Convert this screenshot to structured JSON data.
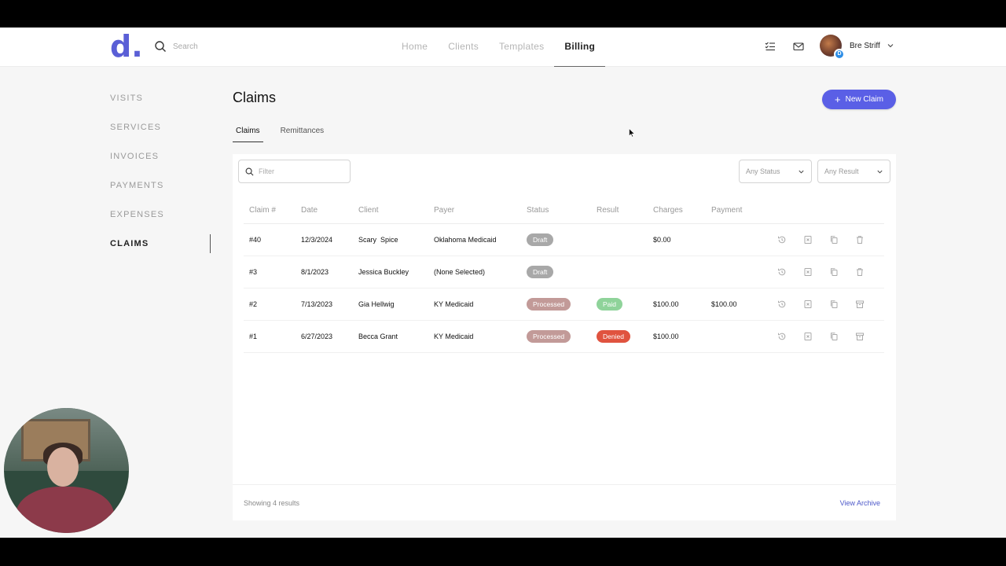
{
  "app": {
    "logo": "d"
  },
  "header": {
    "search_placeholder": "Search",
    "nav": [
      "Home",
      "Clients",
      "Templates",
      "Billing"
    ],
    "active_nav": "Billing",
    "user": {
      "name": "Bre Striff",
      "badge": "D"
    }
  },
  "sidebar": {
    "items": [
      "VISITS",
      "SERVICES",
      "INVOICES",
      "PAYMENTS",
      "EXPENSES",
      "CLAIMS"
    ],
    "active": "CLAIMS"
  },
  "main": {
    "title": "Claims",
    "new_button": "New Claim",
    "tabs": [
      "Claims",
      "Remittances"
    ],
    "filter_placeholder": "Filter",
    "status_select": "Any Status",
    "result_select": "Any Result",
    "columns": [
      "Claim #",
      "Date",
      "Client",
      "Payer",
      "Status",
      "Result",
      "Charges",
      "Payment"
    ],
    "rows": [
      {
        "claim": "#40",
        "date": "12/3/2024",
        "client": "Scary  Spice",
        "payer": "Oklahoma Medicaid",
        "status": "Draft",
        "result": "",
        "charges": "$0.00",
        "payment": ""
      },
      {
        "claim": "#3",
        "date": "8/1/2023",
        "client": "Jessica Buckley",
        "payer": "(None Selected)",
        "status": "Draft",
        "result": "",
        "charges": "",
        "payment": ""
      },
      {
        "claim": "#2",
        "date": "7/13/2023",
        "client": "Gia Hellwig",
        "payer": "KY Medicaid",
        "status": "Processed",
        "result": "Paid",
        "charges": "$100.00",
        "payment": "$100.00"
      },
      {
        "claim": "#1",
        "date": "6/27/2023",
        "client": "Becca Grant",
        "payer": "KY Medicaid",
        "status": "Processed",
        "result": "Denied",
        "charges": "$100.00",
        "payment": ""
      }
    ],
    "footer_count": "Showing 4 results",
    "view_archive": "View Archive"
  },
  "colors": {
    "accent": "#5a5fe6",
    "paid": "#8fd39a",
    "denied": "#e0533f",
    "processed": "#c29a98",
    "draft": "#a8a8a8"
  }
}
